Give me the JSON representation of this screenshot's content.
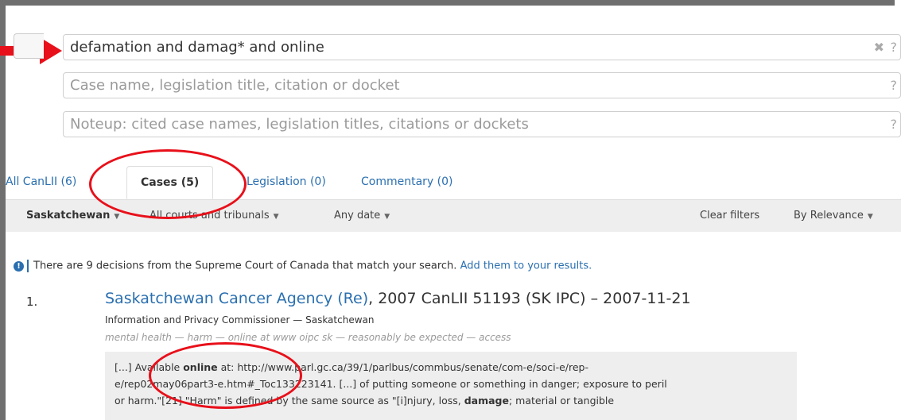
{
  "search": {
    "query": "defamation and damag* and online",
    "case_placeholder": "Case name, legislation title, citation or docket",
    "noteup_placeholder": "Noteup: cited case names, legislation titles, citations or dockets",
    "help": "?",
    "clear": "✖"
  },
  "tabs": [
    {
      "label": "All CanLII (6)"
    },
    {
      "label": "Cases (5)"
    },
    {
      "label": "Legislation (0)"
    },
    {
      "label": "Commentary (0)"
    }
  ],
  "filters": {
    "jurisdiction": "Saskatchewan",
    "courts": "All courts and tribunals",
    "date": "Any date",
    "clear": "Clear filters",
    "sort": "By Relevance"
  },
  "notice": {
    "text": "There are 9 decisions from the Supreme Court of Canada that match your search.",
    "link": "Add them to your results."
  },
  "result": {
    "number": "1.",
    "title": "Saskatchewan Cancer Agency (Re)",
    "citation": ", 2007 CanLII 51193 (SK IPC) – 2007-11-21",
    "court": "Information and Privacy Commissioner — Saskatchewan",
    "keywords": "mental health — harm — online at www oipc sk — reasonably be expected — access",
    "snippet_line1_a": "[...]  Available ",
    "snippet_line1_bold": "online",
    "snippet_line1_b": " at: http://www.parl.gc.ca/39/1/parlbus/commbus/senate/com-e/soci-e/rep-",
    "snippet_line2": "e/rep02may06part3-e.htm#_Toc133223141.  [...]  of putting someone or something in danger; exposure to peril",
    "snippet_line3_a": "or harm.\"[21]  \"Harm\" is defined by the same source as \"[i]njury, loss, ",
    "snippet_line3_bold": "damage",
    "snippet_line3_b": "; material or tangible"
  },
  "colors": {
    "link": "#2a6fb0",
    "annotation": "#e8101a"
  }
}
